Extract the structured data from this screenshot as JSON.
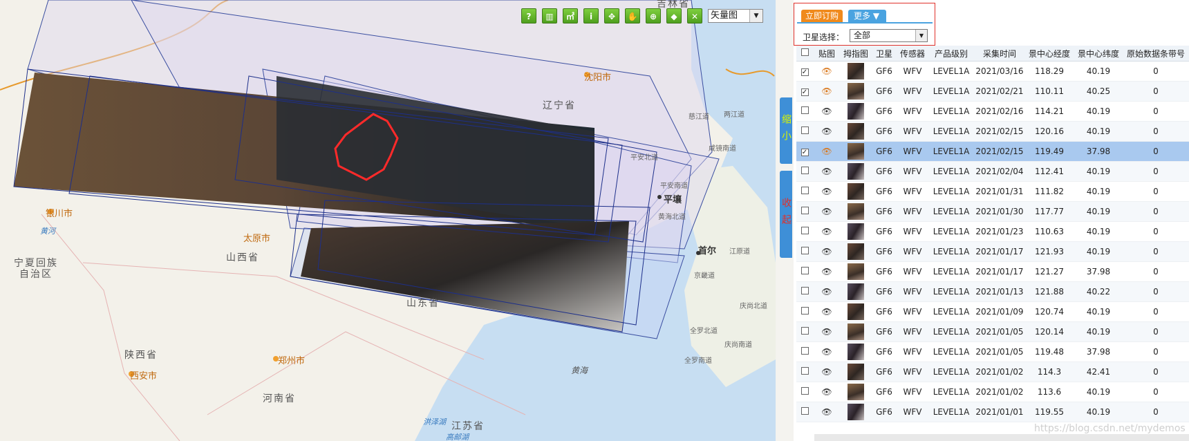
{
  "map": {
    "labels": {
      "heilongjiang_partial": "吉林省",
      "liaoning": "辽宁省",
      "shenyang": "沈阳市",
      "pyongyang": "平壤",
      "seoul": "首尔",
      "yinchuan": "银川市",
      "ningxia_line1": "宁夏回族",
      "ningxia_line2": "自治区",
      "shanxi": "山西省",
      "taiyuan": "太原市",
      "shandong": "山东省",
      "shaanxi": "陕西省",
      "xian": "西安市",
      "zhengzhou": "郑州市",
      "henan": "河南省",
      "jiangsu": "江苏省",
      "yellow_sea": "黄海",
      "yellow_river": "黄河",
      "hongze": "洪泽湖",
      "gaoyou": "高邮湖",
      "cizhou": "慈江道",
      "liangjiang": "两江道",
      "pinganbei": "平安北道",
      "pingannan": "平安南道",
      "huanghainan": "黄海北道",
      "xianjing": "咸镜南道",
      "jiangyuan": "江原道",
      "jingji": "京畿道",
      "qingshangbei": "庆尚北道",
      "quanluobei": "全罗北道",
      "qingshangnan": "庆尚南道",
      "quanluonan": "全罗南道"
    },
    "toolbar": {
      "tools": [
        "?",
        "▥",
        "㎡",
        "i",
        "✥",
        "✋",
        "⊕",
        "◆",
        "✕"
      ],
      "tool_names": [
        "help-icon",
        "ruler-icon",
        "area-measure-icon",
        "info-icon",
        "full-extent-icon",
        "pan-hand-icon",
        "locate-icon",
        "draw-polygon-icon",
        "clear-icon"
      ],
      "maptype_value": "矢量图"
    }
  },
  "side": {
    "shrink_label": "缩小",
    "collapse_label": "收起"
  },
  "panel": {
    "order_button": "立即订购",
    "more_button": "更多",
    "satellite_label": "卫星选择：",
    "satellite_value": "全部",
    "columns": [
      "贴图",
      "拇指图",
      "卫星",
      "传感器",
      "产品级别",
      "采集时间",
      "景中心经度",
      "景中心纬度",
      "原始数据条带号"
    ],
    "rows": [
      {
        "checked": true,
        "eye_on": true,
        "satellite": "GF6",
        "sensor": "WFV",
        "level": "LEVEL1A",
        "date": "2021/03/16",
        "lon": "118.29",
        "lat": "40.19",
        "strip": "0"
      },
      {
        "checked": true,
        "eye_on": true,
        "satellite": "GF6",
        "sensor": "WFV",
        "level": "LEVEL1A",
        "date": "2021/02/21",
        "lon": "110.11",
        "lat": "40.25",
        "strip": "0"
      },
      {
        "checked": false,
        "eye_on": false,
        "satellite": "GF6",
        "sensor": "WFV",
        "level": "LEVEL1A",
        "date": "2021/02/16",
        "lon": "114.21",
        "lat": "40.19",
        "strip": "0"
      },
      {
        "checked": false,
        "eye_on": false,
        "satellite": "GF6",
        "sensor": "WFV",
        "level": "LEVEL1A",
        "date": "2021/02/15",
        "lon": "120.16",
        "lat": "40.19",
        "strip": "0"
      },
      {
        "checked": true,
        "eye_on": true,
        "satellite": "GF6",
        "sensor": "WFV",
        "level": "LEVEL1A",
        "date": "2021/02/15",
        "lon": "119.49",
        "lat": "37.98",
        "strip": "0",
        "selected": true
      },
      {
        "checked": false,
        "eye_on": false,
        "satellite": "GF6",
        "sensor": "WFV",
        "level": "LEVEL1A",
        "date": "2021/02/04",
        "lon": "112.41",
        "lat": "40.19",
        "strip": "0"
      },
      {
        "checked": false,
        "eye_on": false,
        "satellite": "GF6",
        "sensor": "WFV",
        "level": "LEVEL1A",
        "date": "2021/01/31",
        "lon": "111.82",
        "lat": "40.19",
        "strip": "0"
      },
      {
        "checked": false,
        "eye_on": false,
        "satellite": "GF6",
        "sensor": "WFV",
        "level": "LEVEL1A",
        "date": "2021/01/30",
        "lon": "117.77",
        "lat": "40.19",
        "strip": "0"
      },
      {
        "checked": false,
        "eye_on": false,
        "satellite": "GF6",
        "sensor": "WFV",
        "level": "LEVEL1A",
        "date": "2021/01/23",
        "lon": "110.63",
        "lat": "40.19",
        "strip": "0"
      },
      {
        "checked": false,
        "eye_on": false,
        "satellite": "GF6",
        "sensor": "WFV",
        "level": "LEVEL1A",
        "date": "2021/01/17",
        "lon": "121.93",
        "lat": "40.19",
        "strip": "0"
      },
      {
        "checked": false,
        "eye_on": false,
        "satellite": "GF6",
        "sensor": "WFV",
        "level": "LEVEL1A",
        "date": "2021/01/17",
        "lon": "121.27",
        "lat": "37.98",
        "strip": "0"
      },
      {
        "checked": false,
        "eye_on": false,
        "satellite": "GF6",
        "sensor": "WFV",
        "level": "LEVEL1A",
        "date": "2021/01/13",
        "lon": "121.88",
        "lat": "40.22",
        "strip": "0"
      },
      {
        "checked": false,
        "eye_on": false,
        "satellite": "GF6",
        "sensor": "WFV",
        "level": "LEVEL1A",
        "date": "2021/01/09",
        "lon": "120.74",
        "lat": "40.19",
        "strip": "0"
      },
      {
        "checked": false,
        "eye_on": false,
        "satellite": "GF6",
        "sensor": "WFV",
        "level": "LEVEL1A",
        "date": "2021/01/05",
        "lon": "120.14",
        "lat": "40.19",
        "strip": "0"
      },
      {
        "checked": false,
        "eye_on": false,
        "satellite": "GF6",
        "sensor": "WFV",
        "level": "LEVEL1A",
        "date": "2021/01/05",
        "lon": "119.48",
        "lat": "37.98",
        "strip": "0"
      },
      {
        "checked": false,
        "eye_on": false,
        "satellite": "GF6",
        "sensor": "WFV",
        "level": "LEVEL1A",
        "date": "2021/01/02",
        "lon": "114.3",
        "lat": "42.41",
        "strip": "0"
      },
      {
        "checked": false,
        "eye_on": false,
        "satellite": "GF6",
        "sensor": "WFV",
        "level": "LEVEL1A",
        "date": "2021/01/02",
        "lon": "113.6",
        "lat": "40.19",
        "strip": "0"
      },
      {
        "checked": false,
        "eye_on": false,
        "satellite": "GF6",
        "sensor": "WFV",
        "level": "LEVEL1A",
        "date": "2021/01/01",
        "lon": "119.55",
        "lat": "40.19",
        "strip": "0"
      }
    ]
  },
  "watermark": "https://blog.csdn.net/mydemos"
}
